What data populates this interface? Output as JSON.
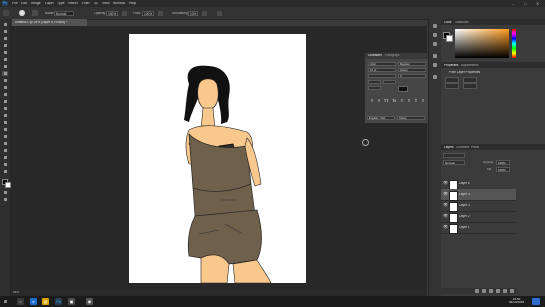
{
  "menubar": {
    "app_icon": "Ps",
    "items": [
      "File",
      "Edit",
      "Image",
      "Layer",
      "Type",
      "Select",
      "Filter",
      "3D",
      "View",
      "Window",
      "Help"
    ]
  },
  "options": {
    "mode_label": "Mode:",
    "mode_value": "Normal",
    "opacity_label": "Opacity:",
    "opacity_value": "100%",
    "flow_label": "Flow:",
    "flow_value": "100%",
    "smoothing_label": "Smoothing:",
    "smoothing_value": "10%"
  },
  "document": {
    "tab_title": "Untitled-1 @ 25% (Layer 4, RGB/8) *",
    "zoom": "25%"
  },
  "character_panel": {
    "tabs": [
      "Character",
      "Paragraph"
    ],
    "font_family": "Arial",
    "font_style": "Regular",
    "size": "12 pt",
    "leading": "(Auto)",
    "tracking": "0",
    "language": "English: USA",
    "aa": "Sharp"
  },
  "right_panels": {
    "color_tabs": [
      "Color",
      "Swatches"
    ],
    "properties_tabs": [
      "Properties",
      "Adjustments"
    ],
    "properties_title": "Pixel Layer Properties",
    "layers_tabs": [
      "Layers",
      "Channels",
      "Paths"
    ],
    "blend_mode": "Normal",
    "opacity_label": "Opacity:",
    "opacity_value": "100%",
    "fill_label": "Fill:",
    "fill_value": "100%",
    "layers": [
      {
        "name": "Layer 5",
        "selected": false
      },
      {
        "name": "Layer 4",
        "selected": true
      },
      {
        "name": "Layer 3",
        "selected": false
      },
      {
        "name": "Layer 2",
        "selected": false
      },
      {
        "name": "Layer 1",
        "selected": false
      }
    ]
  },
  "taskbar": {
    "time": "19:50",
    "date": "06/10/2018"
  },
  "colors": {
    "accent": "#31a8ff",
    "skin": "#f8c88d",
    "clothing": "#6f604c"
  }
}
